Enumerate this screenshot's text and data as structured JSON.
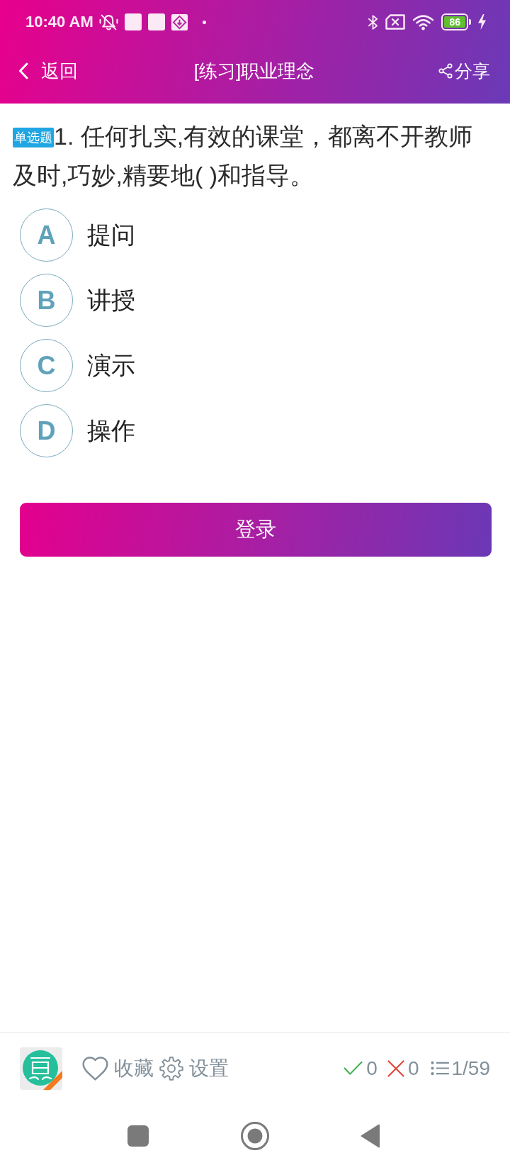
{
  "status_bar": {
    "time": "10:40 AM",
    "battery_text": "86"
  },
  "header": {
    "back_label": "返回",
    "title": "[练习]职业理念",
    "share_label": "分享"
  },
  "question": {
    "type_badge": "单选题",
    "text": "1. 任何扎实,有效的课堂，都离不开教师及时,巧妙,精要地( )和指导。"
  },
  "options": [
    {
      "letter": "A",
      "text": "提问",
      "selected": false
    },
    {
      "letter": "B",
      "text": "讲授",
      "selected": false
    },
    {
      "letter": "C",
      "text": "演示",
      "selected": false
    },
    {
      "letter": "D",
      "text": "操作",
      "selected": false
    }
  ],
  "action_button": {
    "label": "登录"
  },
  "toolbar": {
    "favorite_label": "收藏",
    "favorited": false,
    "settings_label": "设置",
    "correct_count": "0",
    "wrong_count": "0",
    "progress": "1/59"
  }
}
